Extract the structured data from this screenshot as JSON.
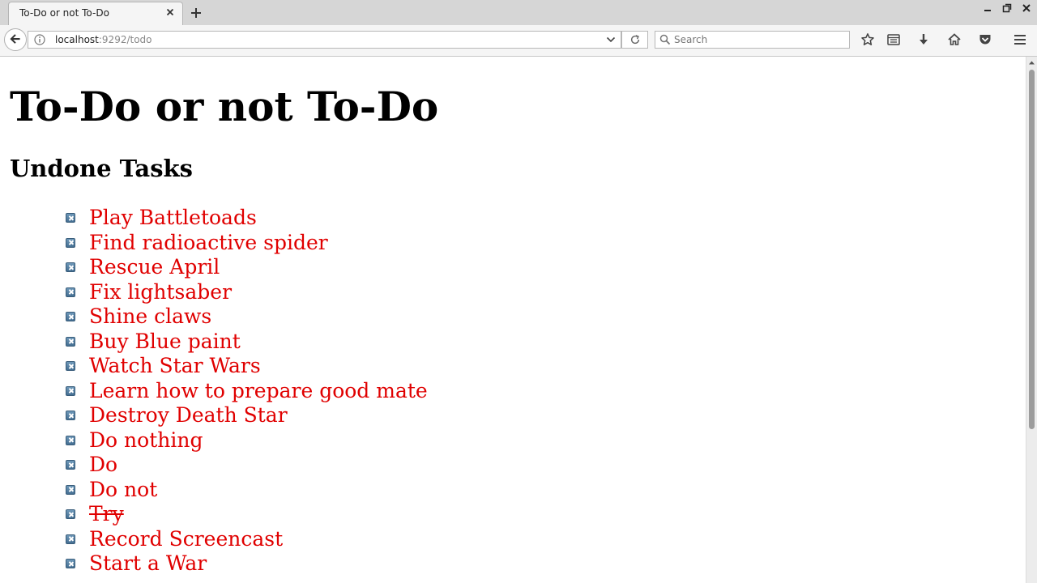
{
  "browser": {
    "tab_title": "To-Do or not To-Do",
    "url_host": "localhost",
    "url_path": ":9292/todo",
    "search_placeholder": "Search"
  },
  "page": {
    "title": "To-Do or not To-Do",
    "section_heading": "Undone Tasks",
    "tasks": [
      {
        "label": "Play Battletoads",
        "done": false
      },
      {
        "label": "Find radioactive spider",
        "done": false
      },
      {
        "label": "Rescue April",
        "done": false
      },
      {
        "label": "Fix lightsaber",
        "done": false
      },
      {
        "label": "Shine claws",
        "done": false
      },
      {
        "label": "Buy Blue paint",
        "done": false
      },
      {
        "label": "Watch Star Wars",
        "done": false
      },
      {
        "label": "Learn how to prepare good mate",
        "done": false
      },
      {
        "label": "Destroy Death Star",
        "done": false
      },
      {
        "label": "Do nothing",
        "done": false
      },
      {
        "label": "Do",
        "done": false
      },
      {
        "label": "Do not",
        "done": false
      },
      {
        "label": "Try",
        "done": true
      },
      {
        "label": "Record Screencast",
        "done": false
      },
      {
        "label": "Start a War",
        "done": false
      }
    ]
  },
  "colors": {
    "task_link": "#e00000",
    "delete_button": "#4f7a9c"
  }
}
